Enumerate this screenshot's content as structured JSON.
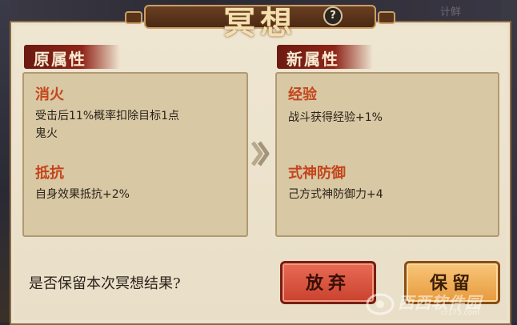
{
  "title": "冥想",
  "help_icon": "?",
  "background_hint": "计鲜",
  "original": {
    "header": "原属性",
    "attrs": [
      {
        "name": "消火",
        "desc_lines": [
          "受击后11%概率扣除目标1点",
          "鬼火"
        ]
      },
      {
        "name": "抵抗",
        "desc_lines": [
          "自身效果抵抗+2%"
        ]
      }
    ]
  },
  "new": {
    "header": "新属性",
    "attrs": [
      {
        "name": "经验",
        "desc_lines": [
          "战斗获得经验+1%"
        ]
      },
      {
        "name": "式神防御",
        "desc_lines": [
          "己方式神防御力+4"
        ]
      }
    ]
  },
  "question": "是否保留本次冥想结果?",
  "buttons": {
    "discard": "放弃",
    "keep": "保留"
  },
  "watermark": {
    "text": "西西软件园",
    "sub": "cr173.com"
  },
  "colors": {
    "attr_name": "#c4451c",
    "discard": "#d9543e",
    "keep": "#f0b05a"
  }
}
